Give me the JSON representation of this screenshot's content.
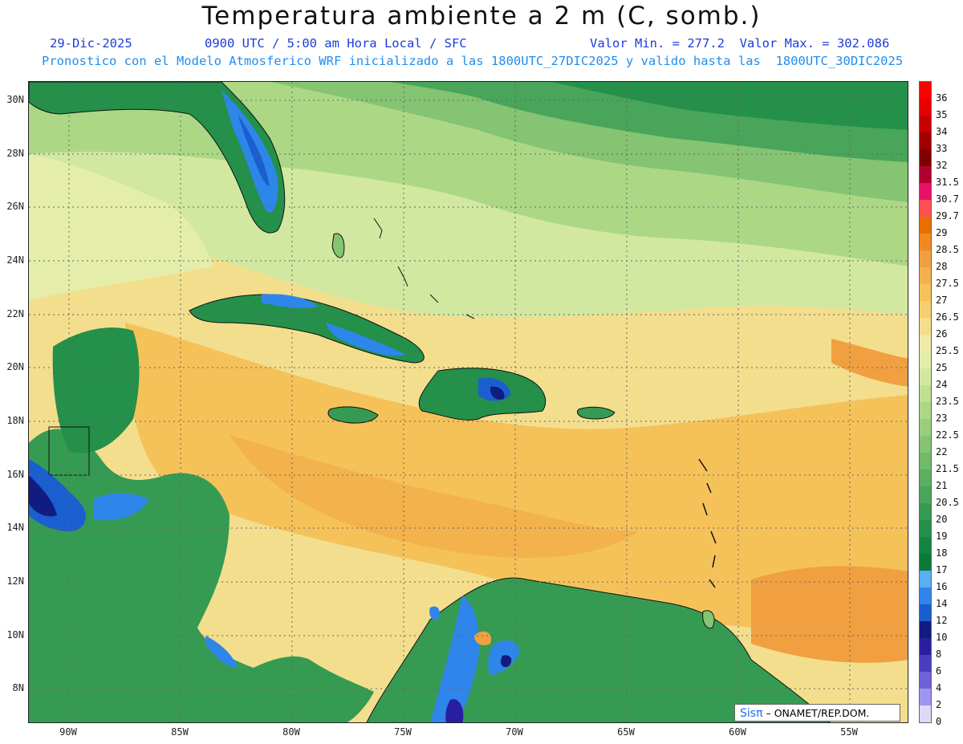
{
  "title": "Temperatura ambiente a 2 m (C, somb.)",
  "date": "29-Dic-2025",
  "time_line": "0900 UTC / 5:00 am Hora Local / SFC",
  "stats": "Valor Min. = 277.2  Valor Max. = 302.086",
  "model_line": "Pronostico con el Modelo Atmosferico WRF inicializado a las 1800UTC_27DIC2025 y valido hasta las  1800UTC_30DIC2025",
  "credit": {
    "brand": "Sisπ",
    "org": "– ONAMET/REP.DOM."
  },
  "colors": {
    "date": "#1e3cd6",
    "model": "#1e8ef0"
  },
  "lat_labels": [
    "30N",
    "28N",
    "26N",
    "24N",
    "22N",
    "20N",
    "18N",
    "16N",
    "14N",
    "12N",
    "10N",
    "8N"
  ],
  "lon_labels": [
    "90W",
    "85W",
    "80W",
    "75W",
    "70W",
    "65W",
    "60W",
    "55W"
  ],
  "legend": [
    {
      "label": "36",
      "color": "#ff0000"
    },
    {
      "label": "35",
      "color": "#e50000"
    },
    {
      "label": "34",
      "color": "#c80000"
    },
    {
      "label": "33",
      "color": "#a00000"
    },
    {
      "label": "32",
      "color": "#800000"
    },
    {
      "label": "31.5",
      "color": "#b00030"
    },
    {
      "label": "30.7",
      "color": "#e8106a"
    },
    {
      "label": "29.7",
      "color": "#ff5050"
    },
    {
      "label": "29",
      "color": "#e87000"
    },
    {
      "label": "28.5",
      "color": "#f08a20"
    },
    {
      "label": "28",
      "color": "#f0a040"
    },
    {
      "label": "27.5",
      "color": "#f3b24c"
    },
    {
      "label": "27",
      "color": "#f5c25a"
    },
    {
      "label": "26.5",
      "color": "#f5d070"
    },
    {
      "label": "26",
      "color": "#f3de8e"
    },
    {
      "label": "25.5",
      "color": "#eeeaa8"
    },
    {
      "label": "25",
      "color": "#e4eeaa"
    },
    {
      "label": "24",
      "color": "#d2e8a0"
    },
    {
      "label": "23.5",
      "color": "#bfe092"
    },
    {
      "label": "23",
      "color": "#acd886"
    },
    {
      "label": "22.5",
      "color": "#98ce7c"
    },
    {
      "label": "22",
      "color": "#84c472"
    },
    {
      "label": "21.5",
      "color": "#70ba6a"
    },
    {
      "label": "21",
      "color": "#5caf62"
    },
    {
      "label": "20.5",
      "color": "#48a55a"
    },
    {
      "label": "20",
      "color": "#369b52"
    },
    {
      "label": "19",
      "color": "#24904a"
    },
    {
      "label": "18",
      "color": "#148442"
    },
    {
      "label": "17",
      "color": "#0a7a3a"
    },
    {
      "label": "16",
      "color": "#5aaef5"
    },
    {
      "label": "14",
      "color": "#2e86ea"
    },
    {
      "label": "12",
      "color": "#1a5ed0"
    },
    {
      "label": "10",
      "color": "#101c80"
    },
    {
      "label": "8",
      "color": "#2a1ea0"
    },
    {
      "label": "6",
      "color": "#4a3ec0"
    },
    {
      "label": "4",
      "color": "#6e62d6"
    },
    {
      "label": "2",
      "color": "#9e96ee"
    },
    {
      "label": "0",
      "color": "#dcdaf8"
    }
  ]
}
